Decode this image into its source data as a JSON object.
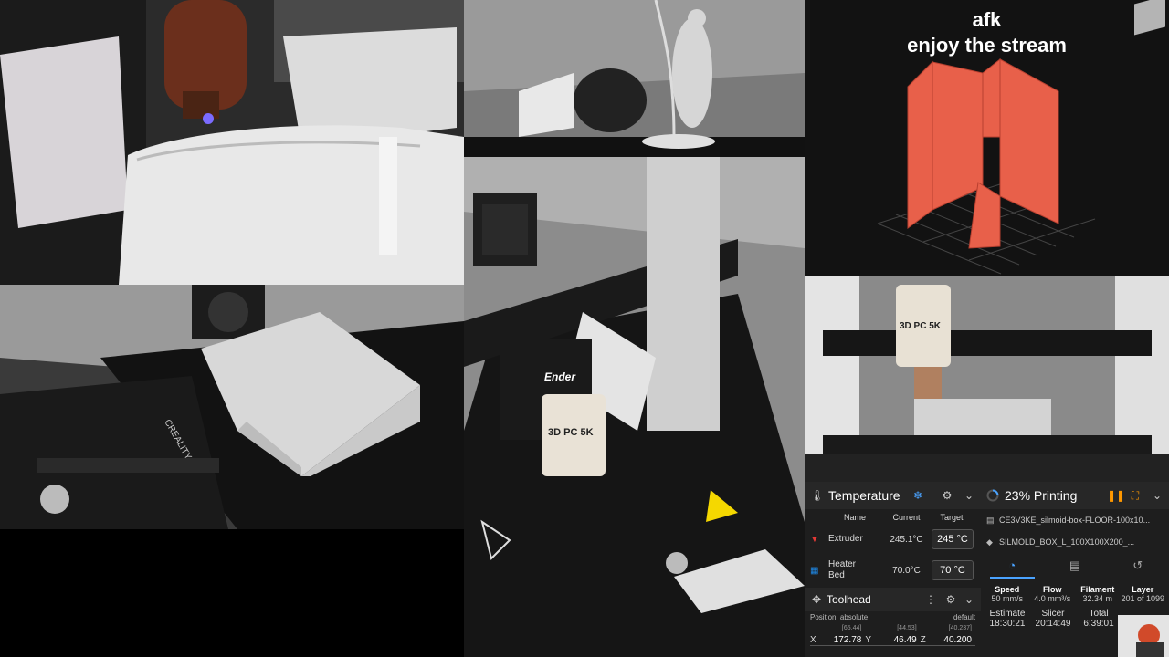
{
  "viewer": {
    "line1": "afk",
    "line2": "enjoy the stream"
  },
  "temperature": {
    "title": "Temperature",
    "columns": {
      "name": "Name",
      "current": "Current",
      "target": "Target"
    },
    "extruder": {
      "name": "Extruder",
      "current": "245.1°C",
      "target": "245",
      "unit": "°C"
    },
    "bed": {
      "name_l1": "Heater",
      "name_l2": "Bed",
      "current": "70.0°C",
      "target": "70",
      "unit": "°C"
    }
  },
  "toolhead": {
    "title": "Toolhead",
    "position_label": "Position: absolute",
    "profile": "default",
    "x": {
      "label": "X",
      "value": "172.78",
      "sup": "[65.44]"
    },
    "y": {
      "label": "Y",
      "value": "46.49",
      "sup": "[44.53]"
    },
    "z": {
      "label": "Z",
      "value": "40.200",
      "sup": "[40.237]"
    }
  },
  "printing": {
    "title": "23% Printing",
    "progress": 0.23,
    "file1": "CE3V3KE_silmoid-box-FLOOR-100x10...",
    "file2": "SILMOLD_BOX_L_100X100X200_...",
    "stats": {
      "speed_label": "Speed",
      "speed": "50 mm/s",
      "flow_label": "Flow",
      "flow": "4.0 mm³/s",
      "filament_label": "Filament",
      "filament": "32.34 m",
      "layer_label": "Layer",
      "layer": "201 of 1099"
    },
    "times": {
      "estimate_label": "Estimate",
      "estimate": "18:30:21",
      "slicer_label": "Slicer",
      "slicer": "20:14:49",
      "total_label": "Total",
      "total": "6:39:01"
    }
  },
  "camera_labels": {
    "bed_text": "CREALITY",
    "head_logo": "Ender",
    "mark": "3D PC 5K"
  }
}
